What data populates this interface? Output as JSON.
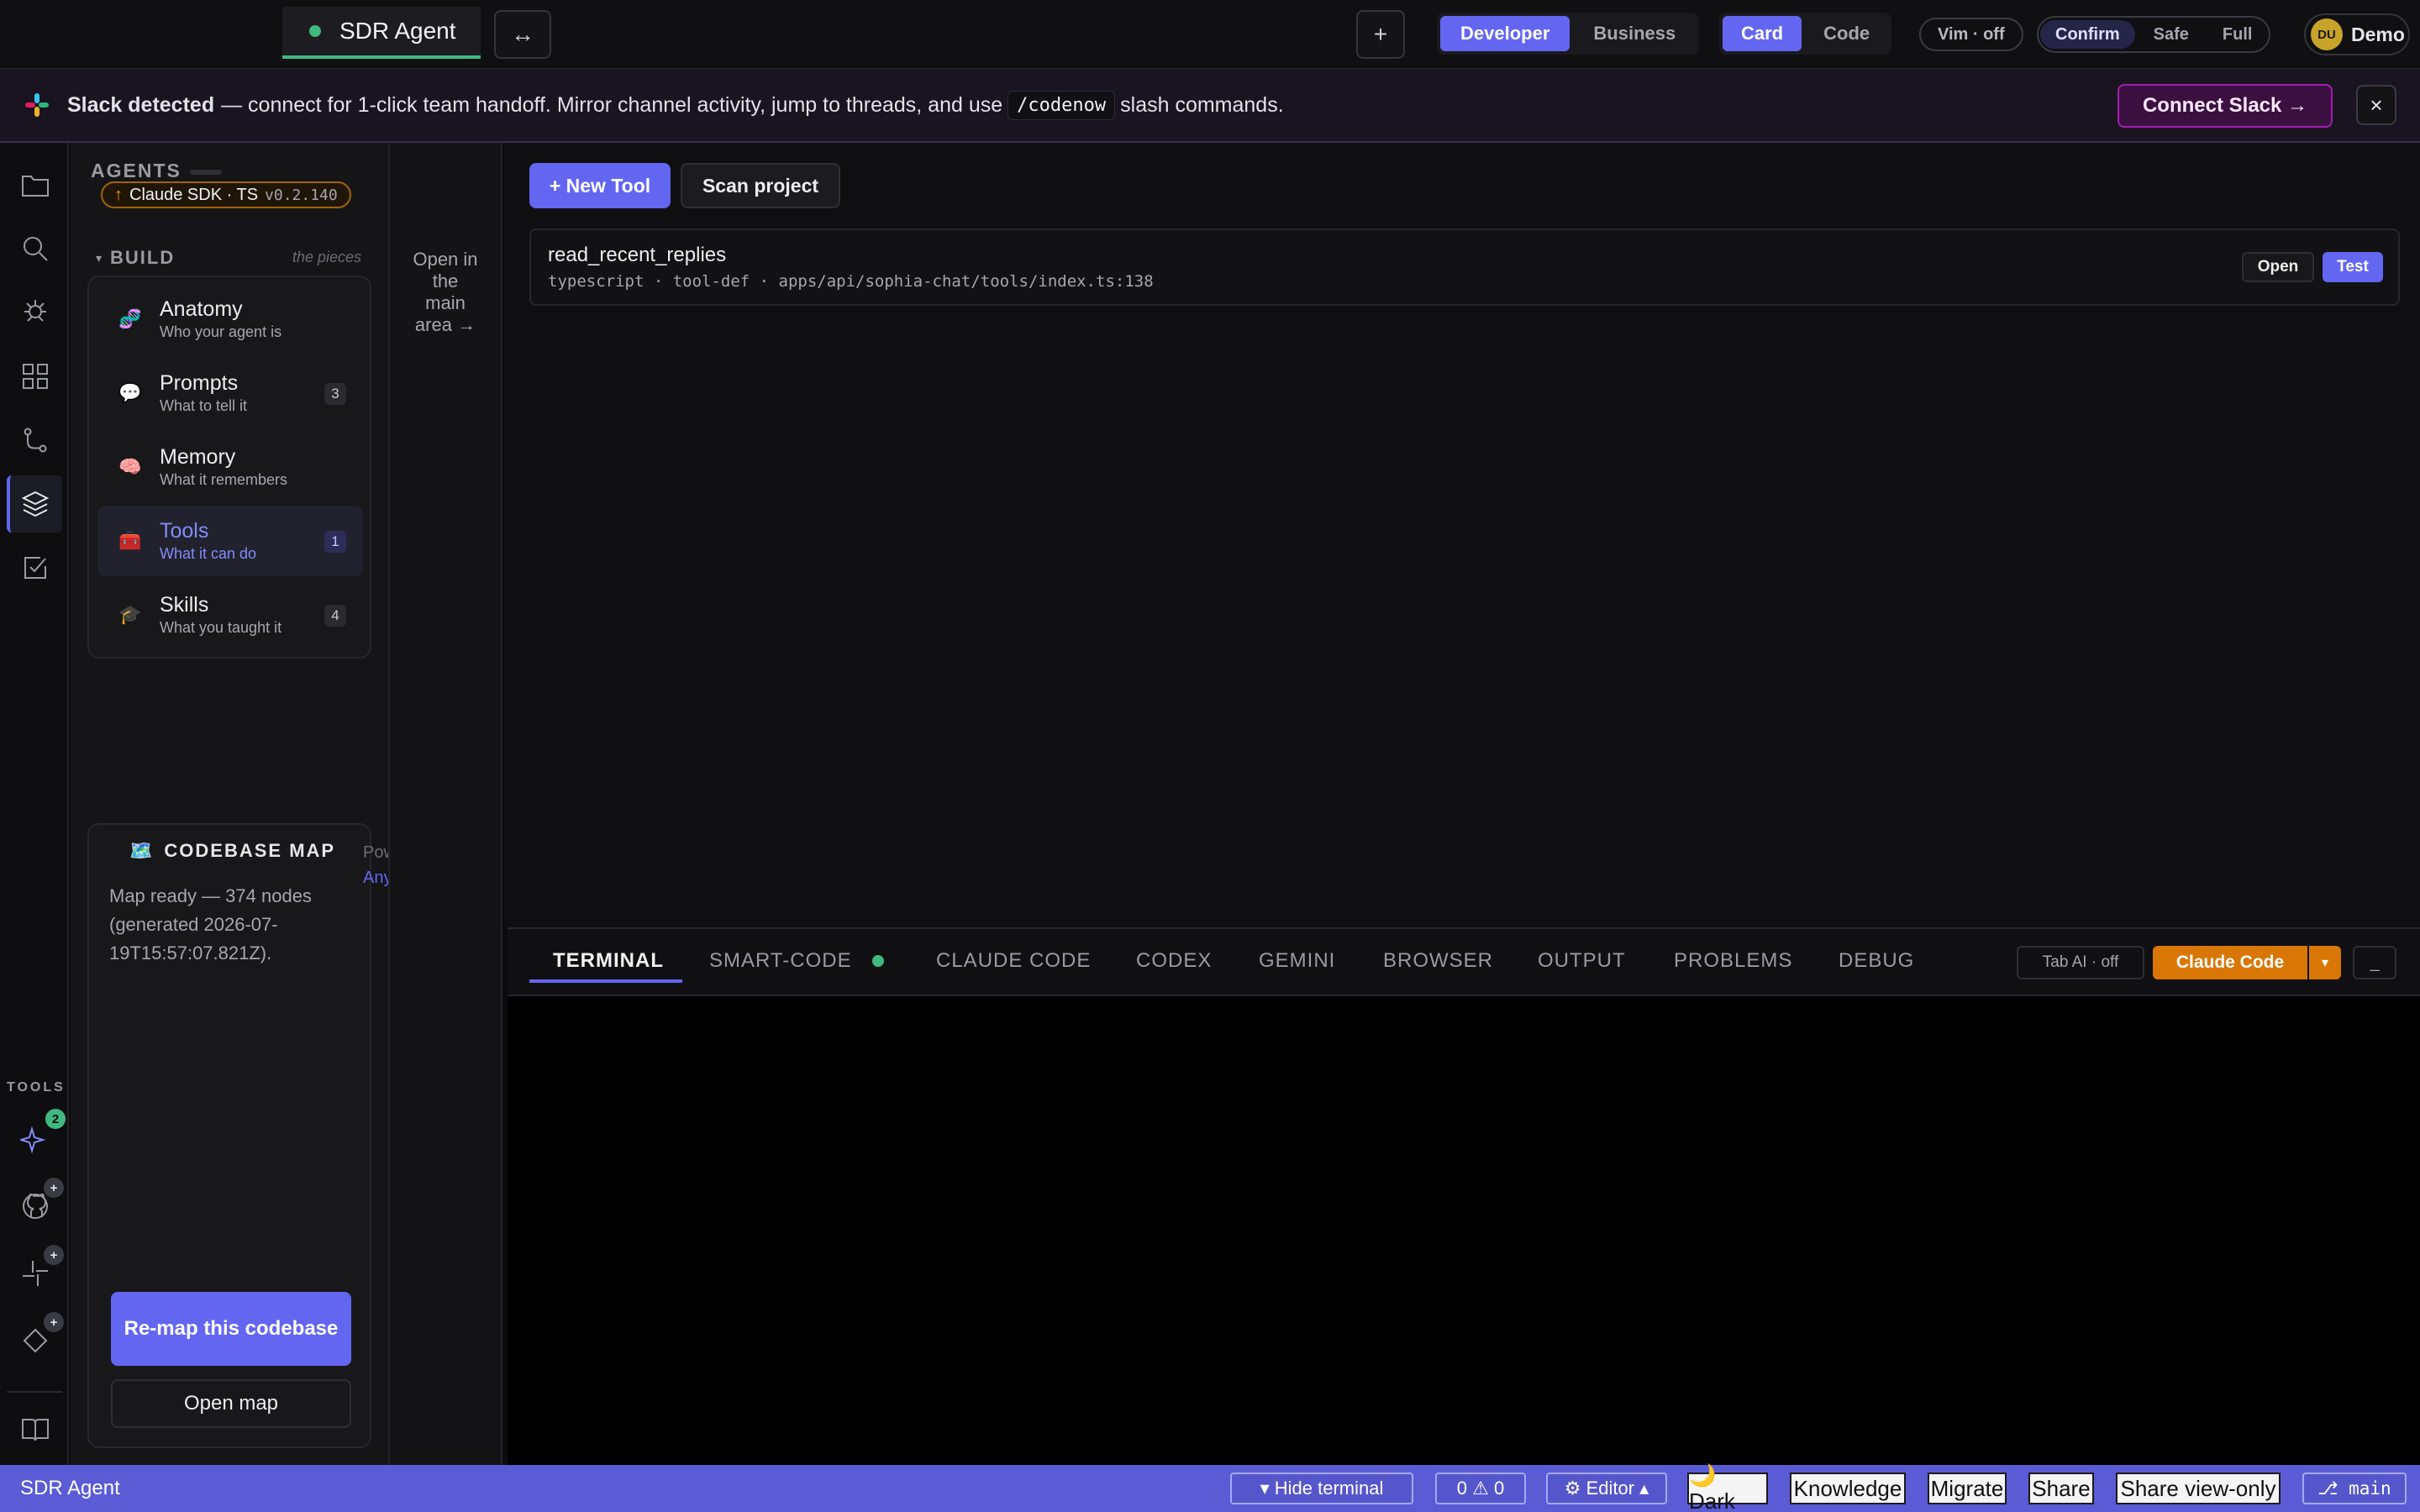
{
  "topbar": {
    "active_tab": "SDR Agent",
    "swap_icon": "↔",
    "add_icon": "+",
    "mode": [
      "Developer",
      "Business"
    ],
    "view": [
      "Card",
      "Code"
    ],
    "vim": "Vim · off",
    "safety": [
      "Confirm",
      "Safe",
      "Full"
    ],
    "user_initials": "DU",
    "user_name": "Demo"
  },
  "banner": {
    "bold": "Slack detected",
    "text1": "— connect for 1-click team handoff. Mirror channel activity, jump to threads, and use",
    "code": "/codenow",
    "text2": "slash commands.",
    "cta": "Connect Slack →",
    "close": "×"
  },
  "rail": {
    "tools_label": "TOOLS",
    "sparkle_badge": "2",
    "plus": "+"
  },
  "agents": {
    "title": "AGENTS",
    "sdk_arrow": "↑",
    "sdk": "Claude SDK · TS",
    "version": "v0.2.140",
    "build_label": "BUILD",
    "build_hint": "the pieces",
    "items": [
      {
        "icon": "🧬",
        "title": "Anatomy",
        "sub": "Who your agent is",
        "count": ""
      },
      {
        "icon": "💬",
        "title": "Prompts",
        "sub": "What to tell it",
        "count": "3"
      },
      {
        "icon": "🧠",
        "title": "Memory",
        "sub": "What it remembers",
        "count": ""
      },
      {
        "icon": "🧰",
        "title": "Tools",
        "sub": "What it can do",
        "count": "1"
      },
      {
        "icon": "🎓",
        "title": "Skills",
        "sub": "What you taught it",
        "count": "4"
      }
    ],
    "open_hint": [
      "Open in",
      "the",
      "main",
      "area →"
    ],
    "map": {
      "icon": "🗺️",
      "title": "CODEBASE MAP",
      "status": "Map ready — 374 nodes (generated 2026-07-19T15:57:07.821Z).",
      "side1": "Pow",
      "side2": "Any",
      "remap": "Re-map this codebase",
      "open": "Open map"
    }
  },
  "main": {
    "new_tool": "+ New Tool",
    "scan": "Scan project",
    "tool": {
      "name": "read_recent_replies",
      "meta": "typescript · tool-def · apps/api/sophia-chat/tools/index.ts:138",
      "open": "Open",
      "test": "Test"
    }
  },
  "terminal": {
    "tabs": [
      "TERMINAL",
      "SMART-CODE",
      "CLAUDE CODE",
      "CODEX",
      "GEMINI",
      "BROWSER",
      "OUTPUT",
      "PROBLEMS",
      "DEBUG"
    ],
    "tab_ai": "Tab AI · off",
    "agent": "Claude Code",
    "dropdown": "▾",
    "minimize": "_"
  },
  "status": {
    "project": "SDR Agent",
    "hide_terminal": "▾ Hide terminal",
    "problems": "0 ⚠ 0",
    "editor": "⚙ Editor ▴",
    "dark": "🌙 Dark",
    "knowledge": "Knowledge",
    "migrate": "Migrate",
    "share": "Share",
    "share_view": "Share view-only",
    "branch": "⎇ main"
  },
  "colors": {
    "accent": "#6366f1",
    "success": "#3fb980",
    "slack_cta": "#a21caf",
    "claude_code": "#d97706"
  }
}
